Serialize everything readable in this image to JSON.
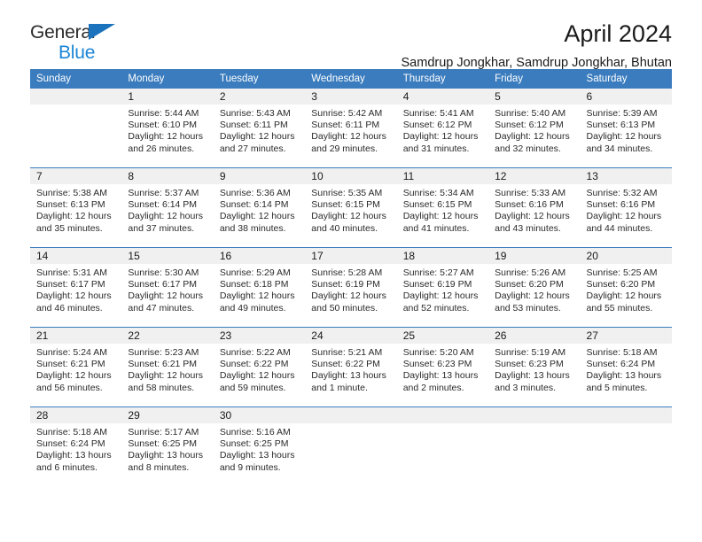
{
  "brand": {
    "line1": "General",
    "line2": "Blue",
    "triangle_color": "#1b72bd",
    "line2_color": "#1b86d6"
  },
  "header": {
    "title": "April 2024",
    "subtitle": "Samdrup Jongkhar, Samdrup Jongkhar, Bhutan"
  },
  "theme": {
    "header_blue": "#3a7cbe",
    "daynum_gray": "#f0f0f0",
    "text": "#1a1a1a"
  },
  "weekdays": [
    "Sunday",
    "Monday",
    "Tuesday",
    "Wednesday",
    "Thursday",
    "Friday",
    "Saturday"
  ],
  "weeks": [
    [
      {
        "day": "",
        "empty": true
      },
      {
        "day": "1",
        "sunrise": "Sunrise: 5:44 AM",
        "sunset": "Sunset: 6:10 PM",
        "daylight": "Daylight: 12 hours and 26 minutes."
      },
      {
        "day": "2",
        "sunrise": "Sunrise: 5:43 AM",
        "sunset": "Sunset: 6:11 PM",
        "daylight": "Daylight: 12 hours and 27 minutes."
      },
      {
        "day": "3",
        "sunrise": "Sunrise: 5:42 AM",
        "sunset": "Sunset: 6:11 PM",
        "daylight": "Daylight: 12 hours and 29 minutes."
      },
      {
        "day": "4",
        "sunrise": "Sunrise: 5:41 AM",
        "sunset": "Sunset: 6:12 PM",
        "daylight": "Daylight: 12 hours and 31 minutes."
      },
      {
        "day": "5",
        "sunrise": "Sunrise: 5:40 AM",
        "sunset": "Sunset: 6:12 PM",
        "daylight": "Daylight: 12 hours and 32 minutes."
      },
      {
        "day": "6",
        "sunrise": "Sunrise: 5:39 AM",
        "sunset": "Sunset: 6:13 PM",
        "daylight": "Daylight: 12 hours and 34 minutes."
      }
    ],
    [
      {
        "day": "7",
        "sunrise": "Sunrise: 5:38 AM",
        "sunset": "Sunset: 6:13 PM",
        "daylight": "Daylight: 12 hours and 35 minutes."
      },
      {
        "day": "8",
        "sunrise": "Sunrise: 5:37 AM",
        "sunset": "Sunset: 6:14 PM",
        "daylight": "Daylight: 12 hours and 37 minutes."
      },
      {
        "day": "9",
        "sunrise": "Sunrise: 5:36 AM",
        "sunset": "Sunset: 6:14 PM",
        "daylight": "Daylight: 12 hours and 38 minutes."
      },
      {
        "day": "10",
        "sunrise": "Sunrise: 5:35 AM",
        "sunset": "Sunset: 6:15 PM",
        "daylight": "Daylight: 12 hours and 40 minutes."
      },
      {
        "day": "11",
        "sunrise": "Sunrise: 5:34 AM",
        "sunset": "Sunset: 6:15 PM",
        "daylight": "Daylight: 12 hours and 41 minutes."
      },
      {
        "day": "12",
        "sunrise": "Sunrise: 5:33 AM",
        "sunset": "Sunset: 6:16 PM",
        "daylight": "Daylight: 12 hours and 43 minutes."
      },
      {
        "day": "13",
        "sunrise": "Sunrise: 5:32 AM",
        "sunset": "Sunset: 6:16 PM",
        "daylight": "Daylight: 12 hours and 44 minutes."
      }
    ],
    [
      {
        "day": "14",
        "sunrise": "Sunrise: 5:31 AM",
        "sunset": "Sunset: 6:17 PM",
        "daylight": "Daylight: 12 hours and 46 minutes."
      },
      {
        "day": "15",
        "sunrise": "Sunrise: 5:30 AM",
        "sunset": "Sunset: 6:17 PM",
        "daylight": "Daylight: 12 hours and 47 minutes."
      },
      {
        "day": "16",
        "sunrise": "Sunrise: 5:29 AM",
        "sunset": "Sunset: 6:18 PM",
        "daylight": "Daylight: 12 hours and 49 minutes."
      },
      {
        "day": "17",
        "sunrise": "Sunrise: 5:28 AM",
        "sunset": "Sunset: 6:19 PM",
        "daylight": "Daylight: 12 hours and 50 minutes."
      },
      {
        "day": "18",
        "sunrise": "Sunrise: 5:27 AM",
        "sunset": "Sunset: 6:19 PM",
        "daylight": "Daylight: 12 hours and 52 minutes."
      },
      {
        "day": "19",
        "sunrise": "Sunrise: 5:26 AM",
        "sunset": "Sunset: 6:20 PM",
        "daylight": "Daylight: 12 hours and 53 minutes."
      },
      {
        "day": "20",
        "sunrise": "Sunrise: 5:25 AM",
        "sunset": "Sunset: 6:20 PM",
        "daylight": "Daylight: 12 hours and 55 minutes."
      }
    ],
    [
      {
        "day": "21",
        "sunrise": "Sunrise: 5:24 AM",
        "sunset": "Sunset: 6:21 PM",
        "daylight": "Daylight: 12 hours and 56 minutes."
      },
      {
        "day": "22",
        "sunrise": "Sunrise: 5:23 AM",
        "sunset": "Sunset: 6:21 PM",
        "daylight": "Daylight: 12 hours and 58 minutes."
      },
      {
        "day": "23",
        "sunrise": "Sunrise: 5:22 AM",
        "sunset": "Sunset: 6:22 PM",
        "daylight": "Daylight: 12 hours and 59 minutes."
      },
      {
        "day": "24",
        "sunrise": "Sunrise: 5:21 AM",
        "sunset": "Sunset: 6:22 PM",
        "daylight": "Daylight: 13 hours and 1 minute."
      },
      {
        "day": "25",
        "sunrise": "Sunrise: 5:20 AM",
        "sunset": "Sunset: 6:23 PM",
        "daylight": "Daylight: 13 hours and 2 minutes."
      },
      {
        "day": "26",
        "sunrise": "Sunrise: 5:19 AM",
        "sunset": "Sunset: 6:23 PM",
        "daylight": "Daylight: 13 hours and 3 minutes."
      },
      {
        "day": "27",
        "sunrise": "Sunrise: 5:18 AM",
        "sunset": "Sunset: 6:24 PM",
        "daylight": "Daylight: 13 hours and 5 minutes."
      }
    ],
    [
      {
        "day": "28",
        "sunrise": "Sunrise: 5:18 AM",
        "sunset": "Sunset: 6:24 PM",
        "daylight": "Daylight: 13 hours and 6 minutes."
      },
      {
        "day": "29",
        "sunrise": "Sunrise: 5:17 AM",
        "sunset": "Sunset: 6:25 PM",
        "daylight": "Daylight: 13 hours and 8 minutes."
      },
      {
        "day": "30",
        "sunrise": "Sunrise: 5:16 AM",
        "sunset": "Sunset: 6:25 PM",
        "daylight": "Daylight: 13 hours and 9 minutes."
      },
      {
        "day": "",
        "empty": true
      },
      {
        "day": "",
        "empty": true
      },
      {
        "day": "",
        "empty": true
      },
      {
        "day": "",
        "empty": true
      }
    ]
  ]
}
